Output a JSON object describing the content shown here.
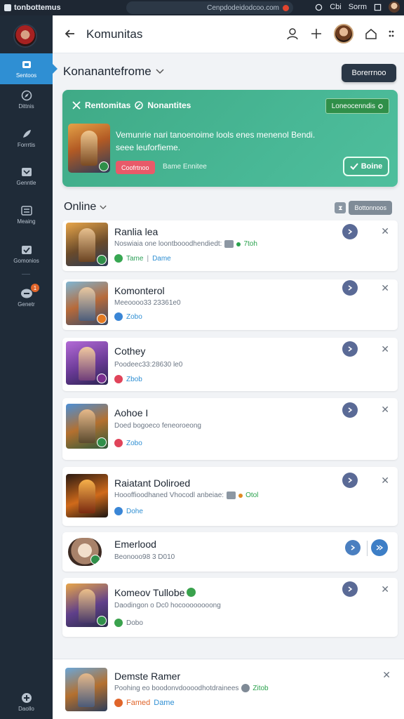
{
  "topbar": {
    "app_name": "tonbottemus",
    "url": "Cenpdodeidodcoo.com",
    "right_a": "Cbi",
    "right_b": "Sorm"
  },
  "sidebar": {
    "items": [
      {
        "label": "Sentoos",
        "icon": "home-icon"
      },
      {
        "label": "Dittnis",
        "icon": "compass-icon"
      },
      {
        "label": "Forrrtis",
        "icon": "rocket-icon"
      },
      {
        "label": "Genntle",
        "icon": "inbox-icon"
      },
      {
        "label": "Meaing",
        "icon": "sliders-icon"
      },
      {
        "label": "Gomonios",
        "icon": "check-icon"
      },
      {
        "label": "Genetr",
        "icon": "chat-icon",
        "badge": "1"
      },
      {
        "label": "Daollo",
        "icon": "gamepad-icon"
      }
    ]
  },
  "header": {
    "title": "Komunitas"
  },
  "community": {
    "name": "Konanantefrome",
    "join_label": "Borerrnoo"
  },
  "featured": {
    "heading_a": "Rentomitas",
    "heading_b": "Nonantites",
    "pill": "Loneocenndis",
    "text": "Vemunrie nari tanoenoime lools enes menenol Bendi. seee leuforfieme.",
    "tag": "Coofrtnoo",
    "sub": "Bame Ennitee",
    "button": "Boine"
  },
  "online": {
    "title": "Online",
    "sort_label": "Bottonnoos"
  },
  "friends": [
    {
      "name": "Ranlia lea",
      "status": "Noswiaia one loontbooodhendiedt:",
      "hours": "7toh",
      "game": "Tame",
      "game2": "Dame"
    },
    {
      "name": "Komonterol",
      "status": "Meeoooo33 23361e0",
      "game": "Zobo"
    },
    {
      "name": "Cothey",
      "status": "Poodeec33:28630 le0",
      "game": "Zbob"
    },
    {
      "name": "Aohoe I",
      "status": "Doed bogoeco feneoroeong",
      "game": "Zobo"
    },
    {
      "name": "Raiatant Doliroed",
      "status": "Hoooffioodhaned Vhocodl anbeiae:",
      "hours": "Otol",
      "game": "Dohe"
    },
    {
      "name": "Emerlood",
      "status": "Beonooo98 3 D010"
    },
    {
      "name": "Komeov Tullobe",
      "status": "Daodingon o Dc0 hocoooooooong",
      "game": "Dobo"
    },
    {
      "name": "Demste Ramer",
      "status": "Poohing eo boodonvdoooodhotdrainees",
      "hours": "Zitob",
      "game": "Famed",
      "game2": "Dame"
    }
  ],
  "colors": {
    "sidebar": "#1f2b38",
    "accent": "#2f8fd3",
    "feature": "#48b795",
    "online_green": "#2aa24d"
  }
}
